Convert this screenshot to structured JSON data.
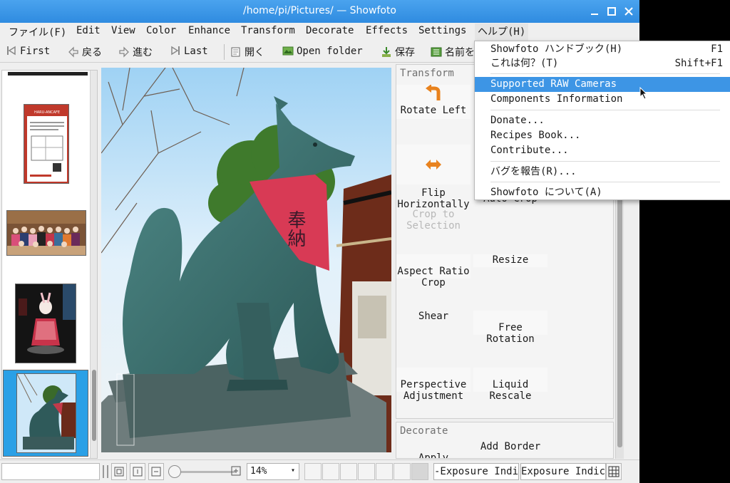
{
  "window": {
    "title": "/home/pi/Pictures/ — Showfoto"
  },
  "menubar": {
    "items": [
      "ファイル(F)",
      "Edit",
      "View",
      "Color",
      "Enhance",
      "Transform",
      "Decorate",
      "Effects",
      "Settings",
      "ヘルプ(H)"
    ]
  },
  "toolbar": {
    "first": "First",
    "back": "戻る",
    "forward": "進む",
    "last": "Last",
    "open": "開く",
    "open_folder": "Open folder",
    "save": "保存",
    "save_as": "名前を"
  },
  "transform_panel": {
    "title": "Transform",
    "tools": {
      "rotate_left": "Rotate Left",
      "flip_horizontally": "Flip\nHorizontally",
      "crop_to_selection": "Crop to\nSelection",
      "auto_crop": "Auto-Crop",
      "aspect_ratio_crop": "Aspect Ratio\nCrop",
      "resize": "Resize",
      "shear": "Shear",
      "free_rotation": "Free\nRotation",
      "perspective_adjustment": "Perspective\nAdjustment",
      "liquid_rescale": "Liquid\nRescale"
    }
  },
  "decorate_panel": {
    "title": "Decorate",
    "tools": {
      "apply_texture": "Apply\nTexture",
      "add_border": "Add Border"
    }
  },
  "statusbar": {
    "zoom": "14%",
    "exposure_indicator_1": "-Exposure Indi",
    "exposure_indicator_2": "Exposure Indic"
  },
  "help_menu": {
    "items": [
      {
        "label": "Showfoto ハンドブック(H)",
        "shortcut": "F1"
      },
      {
        "label": "これは何？(T)",
        "shortcut": "Shift+F1"
      },
      {
        "label": "Supported RAW Cameras",
        "shortcut": ""
      },
      {
        "label": "Components Information",
        "shortcut": ""
      },
      {
        "label": "Donate...",
        "shortcut": ""
      },
      {
        "label": "Recipes Book...",
        "shortcut": ""
      },
      {
        "label": "Contribute...",
        "shortcut": ""
      },
      {
        "label": "バグを報告(R)...",
        "shortcut": ""
      },
      {
        "label": "Showfoto について(A)",
        "shortcut": ""
      }
    ],
    "highlighted_index": 2
  },
  "thumbnails": {
    "sign_text": "HARU-ANCAFE",
    "bib_text": "奉納"
  },
  "colors": {
    "titlebar": "#3b97e8",
    "selection": "#3d95e5",
    "thumb_selected": "#2aa0e6"
  }
}
